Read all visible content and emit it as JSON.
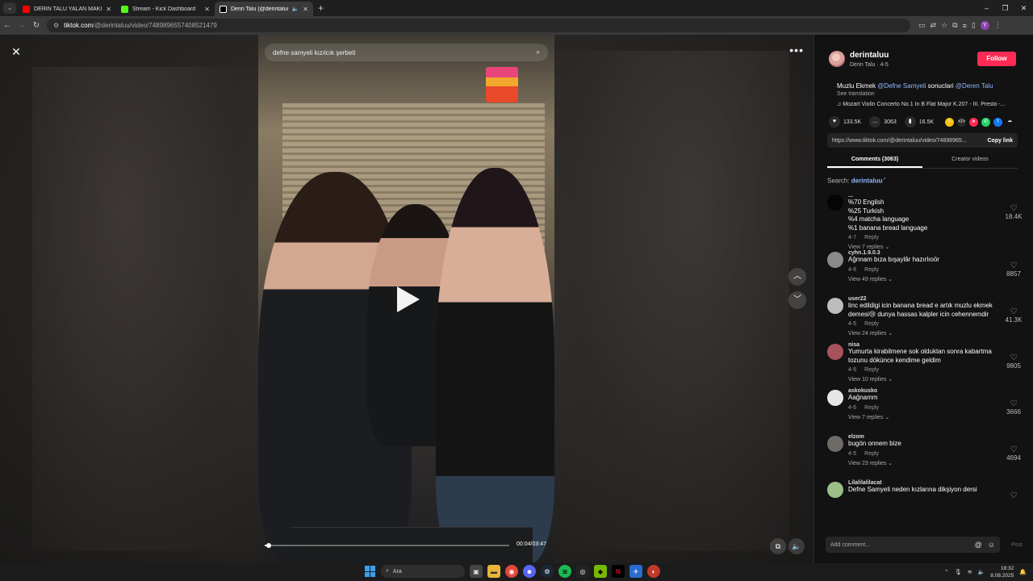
{
  "browser": {
    "tabs": [
      {
        "title": "DERİN TALU YALAN MAKİNESİ",
        "favicon_color": "#ff0000",
        "active": false
      },
      {
        "title": "Stream - Kick Dashboard",
        "favicon_color": "#53fc18",
        "active": false
      },
      {
        "title": "Derin Talu (@derintaluu) | T",
        "favicon_color": "#000000",
        "active": true
      }
    ],
    "new_tab_icon": "plus-icon",
    "url_host": "tiktok.com",
    "url_path": "/@derintaluu/video/7489896557408521479"
  },
  "video": {
    "search_placeholder": "defne samyeli kızılcık şerbeti",
    "time": "00:04/03:47",
    "progress_fraction": 0.018,
    "play_icon": "play-icon"
  },
  "panel": {
    "author_name": "derintaluu",
    "author_sub": "Derin Talu · 4-5",
    "follow_label": "Follow",
    "description_prefix": "Muzlu Ekmek ",
    "mention1": "@Defne Samyeli",
    "description_mid": " sonuclari ",
    "mention2": "@Deren Talu",
    "see_translation": "See translation",
    "music": "♫  Mozart Violin Concerto No.1 In B Flat Major K.207 - III. Presto -...",
    "likes": "133.5K",
    "comments_count": "3063",
    "saves": "16.5K",
    "link": "https://www.tiktok.com/@derintaluu/video/74898965...",
    "copy_link": "Copy link",
    "tab_comments": "Comments (3063)",
    "tab_creator": "Creator videos",
    "search_label": "Search: ",
    "search_query": "derintaluu",
    "comment_placeholder": "Add comment...",
    "post_label": "Post"
  },
  "comments": [
    {
      "user": "...",
      "lines": [
        "%70 English",
        "%25 Turkish",
        "%4 matcha language",
        "%1 banana bread language"
      ],
      "date": "4-7",
      "reply": "Reply",
      "view": "View 7 replies ⌄",
      "likes": "18.4K",
      "avatar_color": "#050505"
    },
    {
      "user": "cyhn.1.9.0.3",
      "lines": [
        "Ağnnam bıza bışaylâr hazırlıoör"
      ],
      "date": "4-6",
      "reply": "Reply",
      "view": "View 49 replies ⌄",
      "likes": "8857",
      "avatar_color": "#8a8a8a"
    },
    {
      "user": "user22",
      "lines": [
        "linc edildigi icin banana bread e artık muzlu ekmek demesi😢 dunya hassas kalpler icin cehennemdir"
      ],
      "date": "4-5",
      "reply": "Reply",
      "view": "View 24 replies ⌄",
      "likes": "41.3K",
      "avatar_color": "#bdbdbd"
    },
    {
      "user": "nisa",
      "lines": [
        "Yumurta kirabilmene sok olduktan sonra kabartma tozunu dökünce kendime geldim"
      ],
      "date": "4-5",
      "reply": "Reply",
      "view": "View 10 replies ⌄",
      "likes": "9805",
      "avatar_color": "#a8535b"
    },
    {
      "user": "askokusko",
      "lines": [
        "Aağnamm"
      ],
      "date": "4-6",
      "reply": "Reply",
      "view": "View 7 replies ⌄",
      "likes": "3666",
      "avatar_color": "#e6e6e6"
    },
    {
      "user": "elzom",
      "lines": [
        "bugön onnem bize"
      ],
      "date": "4-5",
      "reply": "Reply",
      "view": "View 23 replies ⌄",
      "likes": "4694",
      "avatar_color": "#6e6a66"
    },
    {
      "user": "Lilalilalilacat",
      "lines": [
        "Defne Samyeli neden kızlarına dikşiyon dersi"
      ],
      "date": "",
      "reply": "",
      "view": "",
      "likes": "",
      "avatar_color": "#9bbf86"
    }
  ],
  "taskbar": {
    "search_label": "Ara",
    "time": "18:32",
    "date": "8.08.2025"
  },
  "colors": {
    "accent": "#fe2c55",
    "mention": "#8fb8ff"
  }
}
